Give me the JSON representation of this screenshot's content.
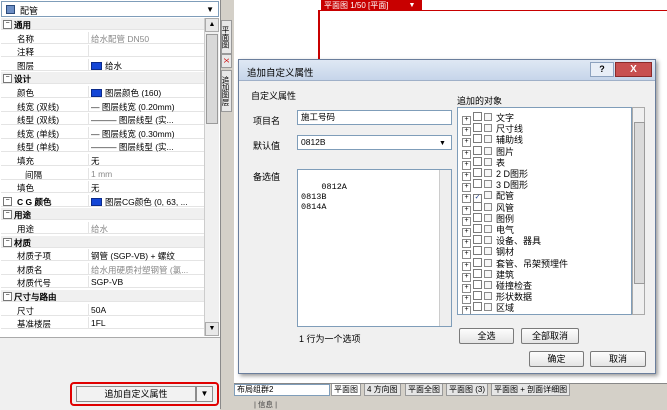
{
  "panel": {
    "type_label": "配管",
    "rows": [
      {
        "kind": "cat",
        "label": "通用",
        "toggle": "⊟"
      },
      {
        "kind": "prop",
        "label": "名称",
        "value": "给水配管 DN50",
        "gray": true
      },
      {
        "kind": "prop",
        "label": "注释",
        "value": ""
      },
      {
        "kind": "prop",
        "label": "图层",
        "value": "给水",
        "swatch": true
      },
      {
        "kind": "cat",
        "label": "设计",
        "toggle": "⊟"
      },
      {
        "kind": "prop",
        "label": "颜色",
        "value": "图层颜色  (160)",
        "swatch": true
      },
      {
        "kind": "prop",
        "label": "线宽 (双线)",
        "value": "— 图层线宽  (0.20mm)"
      },
      {
        "kind": "prop",
        "label": "线型 (双线)",
        "value": "———  图层线型  (实..."
      },
      {
        "kind": "prop",
        "label": "线宽 (单线)",
        "value": "— 图层线宽  (0.30mm)"
      },
      {
        "kind": "prop",
        "label": "线型 (单线)",
        "value": "———  图层线型  (实..."
      },
      {
        "kind": "prop",
        "label": "填充",
        "value": "无"
      },
      {
        "kind": "prop",
        "label": "间隔",
        "value": "1 mm",
        "gray": true,
        "indent": true
      },
      {
        "kind": "prop",
        "label": "填色",
        "value": "无"
      },
      {
        "kind": "prop",
        "label": "C G 颜色",
        "value": "图层CG颜色 (0, 63, ...",
        "swatch": true,
        "boldlabel": true,
        "toggle": "⊟"
      },
      {
        "kind": "cat",
        "label": "用途",
        "toggle": "⊟"
      },
      {
        "kind": "prop",
        "label": "用途",
        "value": "给水",
        "gray": true
      },
      {
        "kind": "cat",
        "label": "材质",
        "toggle": "⊟"
      },
      {
        "kind": "prop",
        "label": "材质子项",
        "value": "钢管 (SGP-VB) + 螺纹"
      },
      {
        "kind": "prop",
        "label": "材质名",
        "value": "给水用硬质衬塑钢管 (氯...",
        "gray": true
      },
      {
        "kind": "prop",
        "label": "材质代号",
        "value": "SGP-VB"
      },
      {
        "kind": "cat",
        "label": "尺寸与路由",
        "toggle": "⊟"
      },
      {
        "kind": "prop",
        "label": "尺寸",
        "value": "50A"
      },
      {
        "kind": "prop",
        "label": "基准楼层",
        "value": "1FL"
      }
    ],
    "add_button": "追加自定义属性"
  },
  "vtabs": [
    "平面图",
    "X",
    "追加图层"
  ],
  "drawing": {
    "tab": "平面图 1/50 [平面]"
  },
  "bottom_tabs": {
    "layout_combo": "布局组群2",
    "tabs": [
      "平面图",
      "4 方向图",
      "平面全图",
      "平面图 (3)",
      "平面图 + 剖面详细图"
    ],
    "status": "| 信息 |"
  },
  "dialog": {
    "title": "追加自定义属性",
    "help": "?",
    "close": "X",
    "section_left": "自定义属性",
    "item_name_label": "项目名",
    "item_name_value": "施工号码",
    "default_label": "默认值",
    "default_value": "0812B",
    "alt_label": "备选值",
    "alt_values": "0812A\n0813B\n0814A",
    "hint": "1 行为一个选项",
    "section_right": "追加的对象",
    "tree": [
      {
        "label": "文字",
        "checked": false
      },
      {
        "label": "尺寸线",
        "checked": false
      },
      {
        "label": "辅助线",
        "checked": false
      },
      {
        "label": "图片",
        "checked": false
      },
      {
        "label": "表",
        "checked": false
      },
      {
        "label": "2 D图形",
        "checked": false
      },
      {
        "label": "3 D图形",
        "checked": false
      },
      {
        "label": "配管",
        "checked": true
      },
      {
        "label": "风管",
        "checked": false
      },
      {
        "label": "图例",
        "checked": false
      },
      {
        "label": "电气",
        "checked": false
      },
      {
        "label": "设备、器具",
        "checked": false
      },
      {
        "label": "钢材",
        "checked": false
      },
      {
        "label": "套管、吊架预埋件",
        "checked": false
      },
      {
        "label": "建筑",
        "checked": false
      },
      {
        "label": "碰撞检查",
        "checked": false
      },
      {
        "label": "形状数据",
        "checked": false
      },
      {
        "label": "区域",
        "checked": false
      }
    ],
    "select_all": "全选",
    "deselect_all": "全部取消",
    "ok": "确定",
    "cancel": "取消"
  }
}
